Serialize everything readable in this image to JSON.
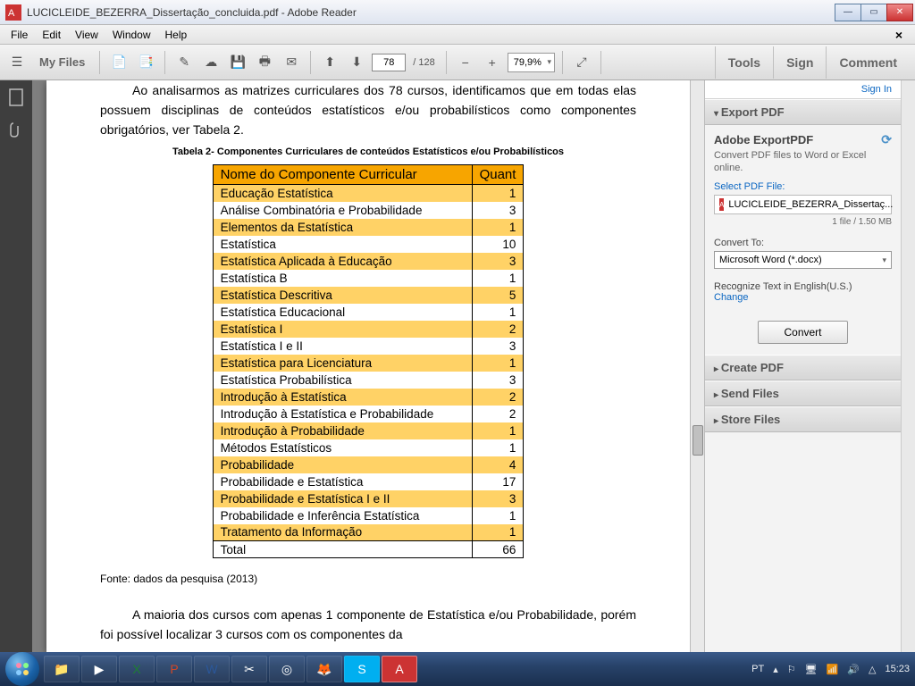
{
  "window": {
    "title": "LUCICLEIDE_BEZERRA_Dissertação_concluida.pdf - Adobe Reader"
  },
  "menu": {
    "file": "File",
    "edit": "Edit",
    "view": "View",
    "window": "Window",
    "help": "Help"
  },
  "toolbar": {
    "my_files": "My Files",
    "page_current": "78",
    "page_total": "/ 128",
    "zoom": "79,9%"
  },
  "actions": {
    "tools": "Tools",
    "sign": "Sign",
    "comment": "Comment"
  },
  "sidepanel": {
    "signin": "Sign In",
    "export_pdf": "Export PDF",
    "adobe_export": "Adobe ExportPDF",
    "export_sub": "Convert PDF files to Word or Excel online.",
    "select_file": "Select PDF File:",
    "filename": "LUCICLEIDE_BEZERRA_Dissertaç...",
    "file_meta": "1 file / 1.50 MB",
    "convert_to": "Convert To:",
    "convert_format": "Microsoft Word (*.docx)",
    "recognize": "Recognize Text in English(U.S.)",
    "change": "Change",
    "convert_btn": "Convert",
    "create_pdf": "Create PDF",
    "send_files": "Send Files",
    "store_files": "Store Files"
  },
  "document": {
    "para1": "Ao analisarmos as matrizes curriculares dos 78 cursos, identificamos que em todas elas possuem disciplinas de conteúdos estatísticos e/ou probabilísticos como componentes obrigatórios, ver Tabela 2.",
    "caption": "Tabela 2- Componentes Curriculares de conteúdos Estatísticos e/ou Probabilísticos",
    "header_name": "Nome do Componente Curricular",
    "header_quant": "Quant",
    "rows": [
      {
        "n": "Educação Estatística",
        "q": "1"
      },
      {
        "n": "Análise Combinatória e Probabilidade",
        "q": "3"
      },
      {
        "n": "Elementos da Estatística",
        "q": "1"
      },
      {
        "n": "Estatística",
        "q": "10"
      },
      {
        "n": "Estatística Aplicada à Educação",
        "q": "3"
      },
      {
        "n": "Estatística B",
        "q": "1"
      },
      {
        "n": "Estatística Descritiva",
        "q": "5"
      },
      {
        "n": "Estatística Educacional",
        "q": "1"
      },
      {
        "n": "Estatística I",
        "q": "2"
      },
      {
        "n": "Estatística I e II",
        "q": "3"
      },
      {
        "n": "Estatística para Licenciatura",
        "q": "1"
      },
      {
        "n": "Estatística Probabilística",
        "q": "3"
      },
      {
        "n": "Introdução à Estatística",
        "q": "2"
      },
      {
        "n": "Introdução à Estatística e Probabilidade",
        "q": "2"
      },
      {
        "n": "Introdução à Probabilidade",
        "q": "1"
      },
      {
        "n": "Métodos Estatísticos",
        "q": "1"
      },
      {
        "n": "Probabilidade",
        "q": "4"
      },
      {
        "n": "Probabilidade e Estatística",
        "q": "17"
      },
      {
        "n": "Probabilidade e Estatística I e II",
        "q": "3"
      },
      {
        "n": "Probabilidade e Inferência Estatística",
        "q": "1"
      },
      {
        "n": "Tratamento da Informação",
        "q": "1"
      }
    ],
    "total_label": "Total",
    "total_value": "66",
    "fonte": "Fonte: dados da pesquisa (2013)",
    "para2": "A maioria dos cursos com apenas 1 componente de Estatística e/ou Probabilidade, porém foi possível localizar 3 cursos com os componentes da"
  },
  "taskbar": {
    "lang": "PT",
    "clock": "15:23"
  }
}
